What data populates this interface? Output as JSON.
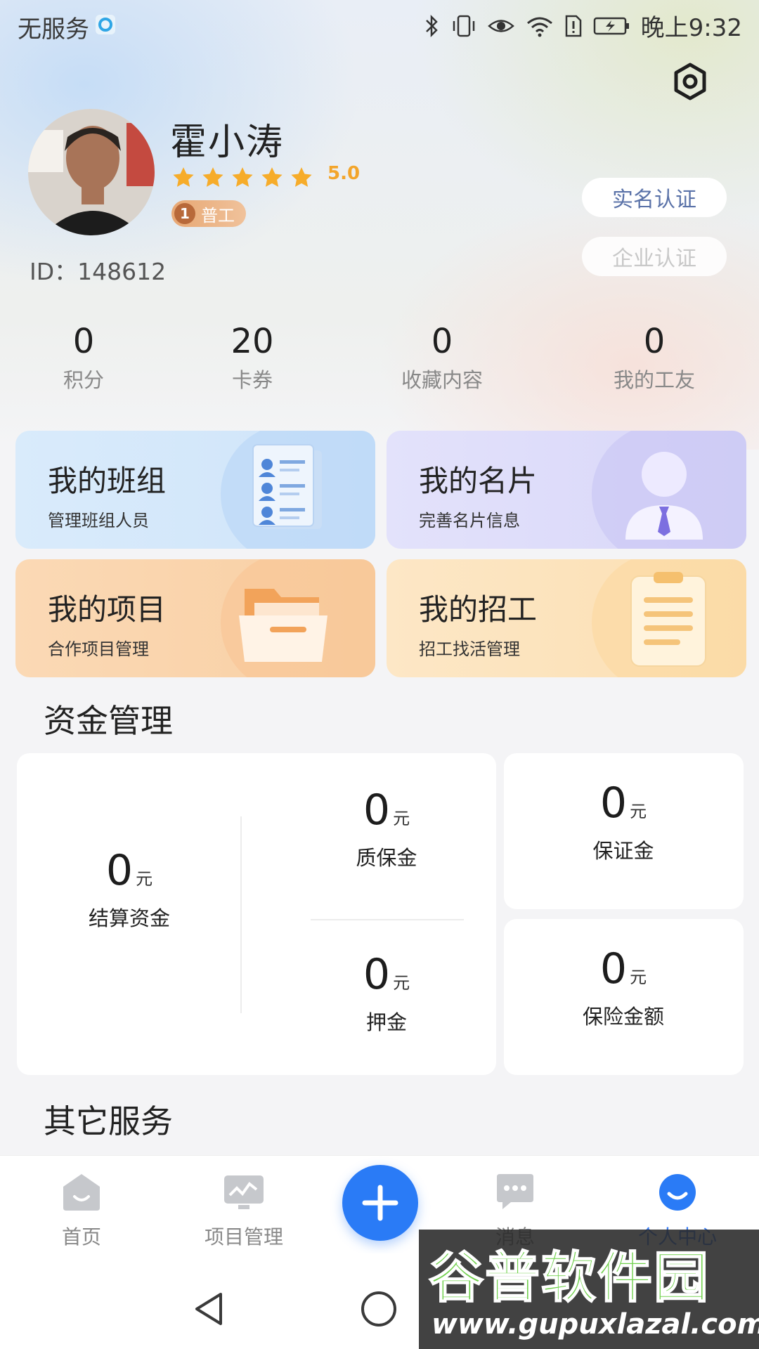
{
  "status_bar": {
    "carrier": "无服务",
    "time": "晚上9:32"
  },
  "profile": {
    "name": "霍小涛",
    "rating": "5.0",
    "stars": 5,
    "badge_level": "1",
    "badge_label": "普工",
    "id_text": "ID：148612",
    "real_name_button": "实名认证",
    "enterprise_button": "企业认证"
  },
  "stats": [
    {
      "value": "0",
      "label": "积分"
    },
    {
      "value": "20",
      "label": "卡券"
    },
    {
      "value": "0",
      "label": "收藏内容"
    },
    {
      "value": "0",
      "label": "我的工友"
    }
  ],
  "feature_cards": [
    {
      "title": "我的班组",
      "subtitle": "管理班组人员"
    },
    {
      "title": "我的名片",
      "subtitle": "完善名片信息"
    },
    {
      "title": "我的项目",
      "subtitle": "合作项目管理"
    },
    {
      "title": "我的招工",
      "subtitle": "招工找活管理"
    }
  ],
  "funds": {
    "section_title": "资金管理",
    "unit": "元",
    "settlement": {
      "value": "0",
      "label": "结算资金"
    },
    "warranty": {
      "value": "0",
      "label": "质保金"
    },
    "deposit": {
      "value": "0",
      "label": "押金"
    },
    "security": {
      "value": "0",
      "label": "保证金"
    },
    "insurance": {
      "value": "0",
      "label": "保险金额"
    }
  },
  "other_services_title": "其它服务",
  "tabs": [
    {
      "label": "首页",
      "active": false
    },
    {
      "label": "项目管理",
      "active": false
    },
    {
      "label": "消息",
      "active": false
    },
    {
      "label": "个人中心",
      "active": true
    }
  ],
  "watermark": {
    "line1": "谷普软件园",
    "line2": "www.gupuxlazal.com"
  },
  "colors": {
    "accent": "#2a7bf6",
    "rating": "#f3a52b",
    "badge": "#e7a773"
  }
}
